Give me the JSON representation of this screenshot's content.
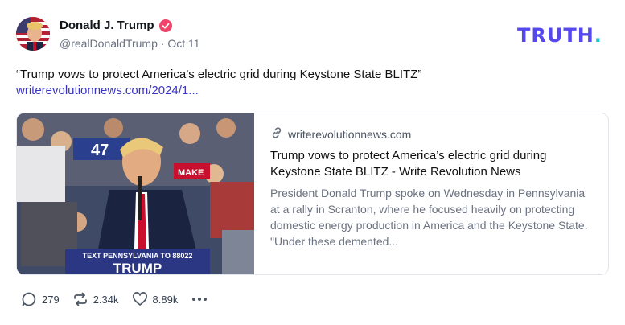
{
  "author": {
    "name": "Donald J. Trump",
    "handle": "@realDonaldTrump",
    "separator": "·",
    "date": "Oct 11",
    "verified_color": "#f0456a"
  },
  "brand": {
    "logo_text": "TRUTH",
    "logo_dot": ".",
    "logo_color": "#5448ee",
    "dot_color": "#19c6d3"
  },
  "post": {
    "text": "“Trump vows to protect America’s electric grid during Keystone State BLITZ”",
    "link": "writerevolutionnews.com/2024/1..."
  },
  "card": {
    "domain": "writerevolutionnews.com",
    "domain_icon": "link-icon",
    "title": "Trump vows to protect America’s electric grid during Keystone State BLITZ - Write Revolution News",
    "description": "President Donald Trump spoke on Wednesday in Pennsylvania at a rally in Scranton, where he focused heavily on protecting domestic energy production in America and the Keystone State. \"Under these demented...",
    "image": {
      "sign_top": "TEXT PENNSYLVANIA TO 88022",
      "sign_bottom": "TRUMP",
      "rally_sign": "MAKE",
      "crowd_number": "47"
    }
  },
  "actions": {
    "replies": "279",
    "reposts": "2.34k",
    "likes": "8.89k"
  }
}
